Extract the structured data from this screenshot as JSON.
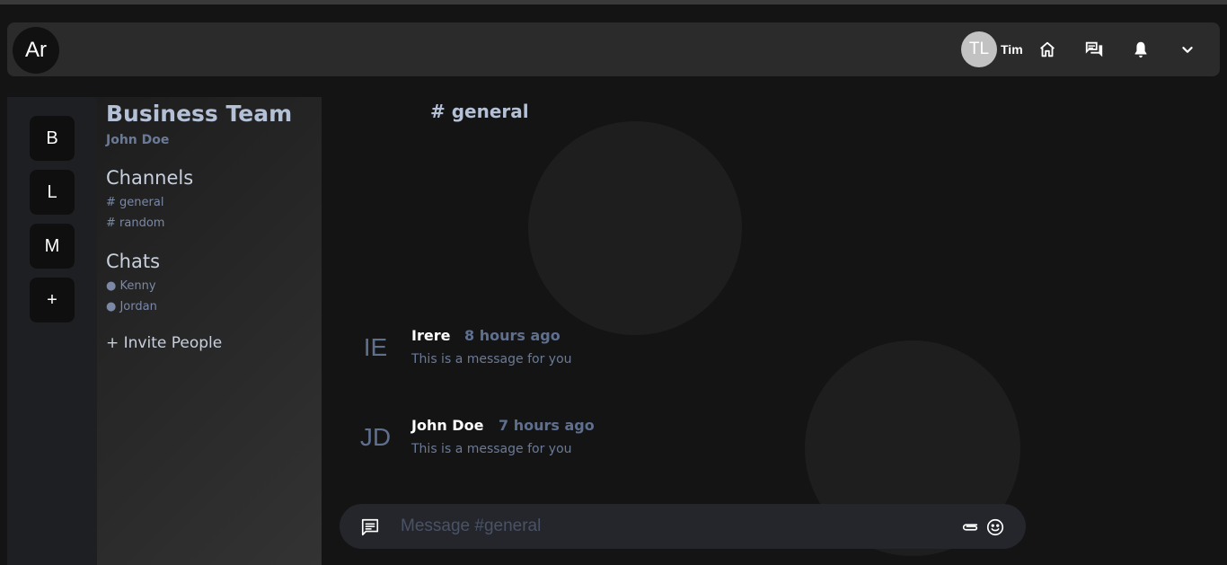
{
  "header": {
    "logo_text": "Ar",
    "user_initials": "TL",
    "user_name": "Tim",
    "icons": [
      "home-icon",
      "chat-bubbles-icon",
      "bell-icon",
      "chevron-down-icon"
    ]
  },
  "rail": {
    "items": [
      "B",
      "L",
      "M",
      "+"
    ]
  },
  "panel": {
    "team_name": "Business Team",
    "user_name": "John Doe",
    "channels_heading": "Channels",
    "channels": [
      "# general",
      "# random"
    ],
    "chats_heading": "Chats",
    "chats": [
      "● Kenny",
      "● Jordan"
    ],
    "invite_label": "+ Invite People"
  },
  "main": {
    "channel_title": "# general",
    "messages": [
      {
        "initials": "IE",
        "author": "Irere",
        "time": "8 hours ago",
        "text": "This is a message for you"
      },
      {
        "initials": "JD",
        "author": "John Doe",
        "time": "7 hours ago",
        "text": "This is a message for you"
      }
    ],
    "composer": {
      "placeholder": "Message #general",
      "value": ""
    }
  },
  "colors": {
    "background": "#141414",
    "header": "#2b2b2b",
    "accent_text": "#b4c0d6",
    "muted_text": "#6b7a96"
  }
}
